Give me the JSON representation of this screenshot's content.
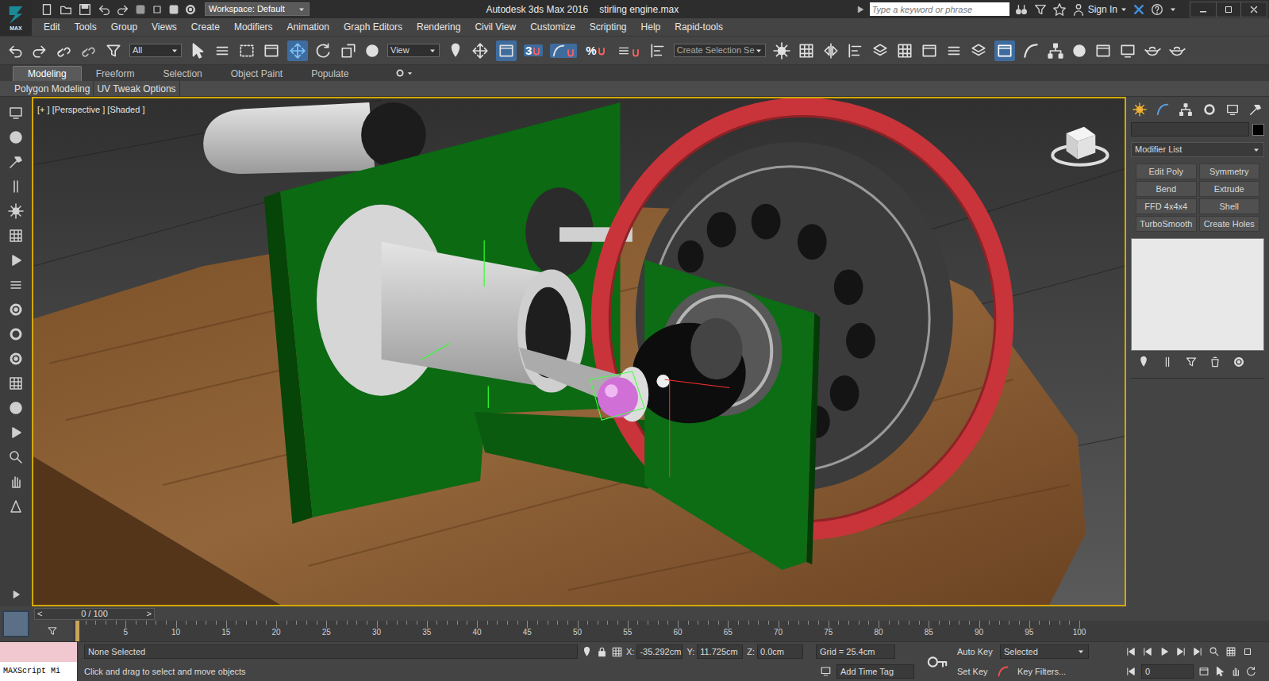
{
  "app": {
    "logo": "MAX",
    "workspace": "Workspace: Default",
    "title": "Autodesk 3ds Max 2016",
    "file": "stirling engine.max",
    "search": {
      "placeholder": "Type a keyword or phrase"
    },
    "sign_in": "Sign In"
  },
  "menu": [
    "Edit",
    "Tools",
    "Group",
    "Views",
    "Create",
    "Modifiers",
    "Animation",
    "Graph Editors",
    "Rendering",
    "Civil View",
    "Customize",
    "Scripting",
    "Help",
    "Rapid-tools"
  ],
  "toolbar": {
    "selection_filter": "All",
    "reference_coordinates": "View",
    "angle_snap": "3",
    "percent_snap": "%",
    "named_selection": "Create Selection Se",
    "toggles": {
      "move": true,
      "placement": true,
      "angle_snap": true,
      "ribbon": true
    }
  },
  "ribbon": {
    "tabs": [
      {
        "label": "Modeling",
        "selected": true
      },
      {
        "label": "Freeform",
        "selected": false
      },
      {
        "label": "Selection",
        "selected": false
      },
      {
        "label": "Object Paint",
        "selected": false
      },
      {
        "label": "Populate",
        "selected": false
      }
    ],
    "panels": [
      "Polygon Modeling",
      "UV Tweak Options"
    ]
  },
  "viewport": {
    "label": "[+ ] [Perspective ] [Shaded ]",
    "active": true
  },
  "command_panel": {
    "modifier_list": "Modifier List",
    "modifier_buttons": [
      "Edit Poly",
      "Symmetry",
      "Bend",
      "Extrude",
      "FFD 4x4x4",
      "Shell",
      "TurboSmooth",
      "Create Holes"
    ]
  },
  "timeline": {
    "position": "0 / 100",
    "prev": "<",
    "next": ">",
    "ticks": [
      "5",
      "10",
      "15",
      "20",
      "25",
      "30",
      "35",
      "40",
      "45",
      "50",
      "55",
      "60",
      "65",
      "70",
      "75",
      "80",
      "85",
      "90",
      "95",
      "100"
    ]
  },
  "status": {
    "selection": "None Selected",
    "prompt": "Click and drag to select and move objects",
    "coords": [
      {
        "axis": "X:",
        "value": "-35.292cm"
      },
      {
        "axis": "Y:",
        "value": "11.725cm"
      },
      {
        "axis": "Z:",
        "value": "0.0cm"
      }
    ],
    "grid": "Grid = 25.4cm",
    "add_time_tag": "Add Time Tag",
    "maxscript": "MAXScript Mi",
    "auto_key": "Auto Key",
    "key_mode": "Selected",
    "set_key": "Set Key",
    "key_filters": "Key Filters...",
    "current_frame": "0"
  }
}
